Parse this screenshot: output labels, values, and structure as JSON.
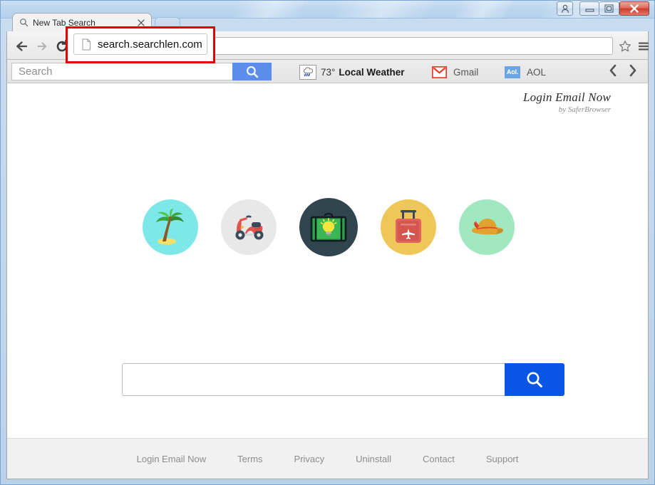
{
  "window": {
    "controls": {
      "user_label": "user-account",
      "minimize_label": "Minimize",
      "maximize_label": "Maximize",
      "close_label": "Close"
    }
  },
  "browser": {
    "tab": {
      "title": "New Tab Search",
      "favicon": "search-icon",
      "close": "×"
    },
    "new_tab_label": "+",
    "nav": {
      "back": "back-arrow",
      "forward": "forward-arrow",
      "reload": "reload-icon"
    },
    "omnibox": {
      "url": "search.searchlen.com",
      "favicon": "page-icon"
    },
    "star_label": "bookmark-star",
    "menu_label": "chrome-menu"
  },
  "annotation": {
    "url": "search.searchlen.com",
    "highlight_color": "#e50000"
  },
  "ext_toolbar": {
    "search": {
      "placeholder": "Search",
      "value": "",
      "button_label": "search"
    },
    "weather": {
      "temperature": "73°",
      "label": "Local Weather",
      "icon": "rain-cloud-icon"
    },
    "gmail": {
      "label": "Gmail",
      "icon": "gmail-envelope-icon"
    },
    "aol": {
      "label": "AOL",
      "icon": "aol-logo-icon",
      "badge": "Aol."
    },
    "prev_label": "‹",
    "next_label": "›"
  },
  "page": {
    "brand": {
      "title": "Login Email Now",
      "subtitle": "by SaferBrowser"
    },
    "icons": [
      {
        "name": "palm-tree",
        "circle_color": "#7ee8e8",
        "size": "normal"
      },
      {
        "name": "scooter",
        "circle_color": "#e8e8e8",
        "size": "normal"
      },
      {
        "name": "briefcase-idea",
        "circle_color": "#31454f",
        "size": "big"
      },
      {
        "name": "suitcase-flight",
        "circle_color": "#efc759",
        "size": "normal"
      },
      {
        "name": "sun-hat",
        "circle_color": "#9fe8c0",
        "size": "normal"
      }
    ],
    "search": {
      "value": "",
      "placeholder": "",
      "button_label": "search",
      "button_color": "#0a56e4"
    },
    "footer_links": [
      "Login Email Now",
      "Terms",
      "Privacy",
      "Uninstall",
      "Contact",
      "Support"
    ]
  }
}
